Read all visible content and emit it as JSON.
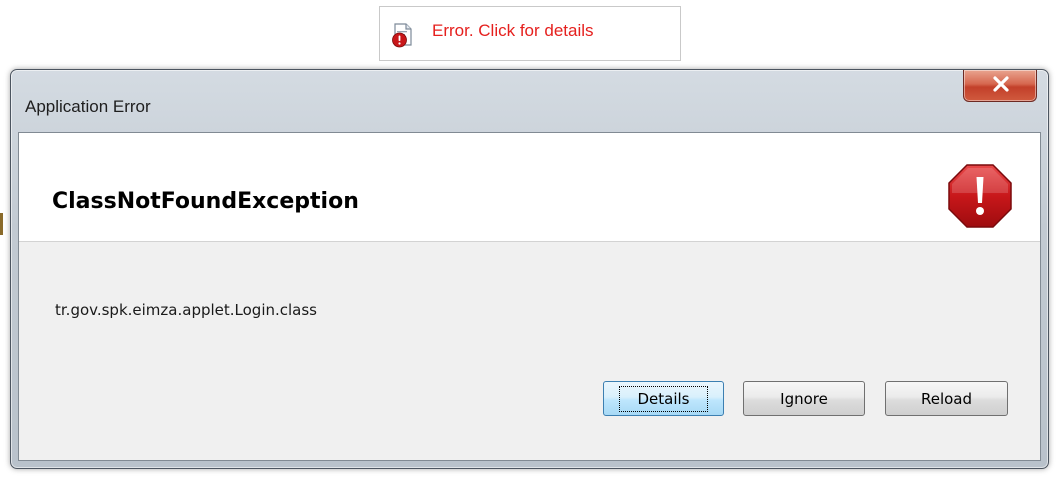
{
  "applet_banner": {
    "text": "Error. Click for details",
    "icon": "document-error-icon",
    "text_color": "#e5201e"
  },
  "window": {
    "title": "Application Error",
    "close_icon": "close-icon"
  },
  "dialog": {
    "exception": "ClassNotFoundException",
    "message": "tr.gov.spk.eimza.applet.Login.class",
    "icon": "stop-error-icon",
    "icon_color": "#c8171a"
  },
  "buttons": {
    "details": "Details",
    "ignore": "Ignore",
    "reload": "Reload"
  }
}
